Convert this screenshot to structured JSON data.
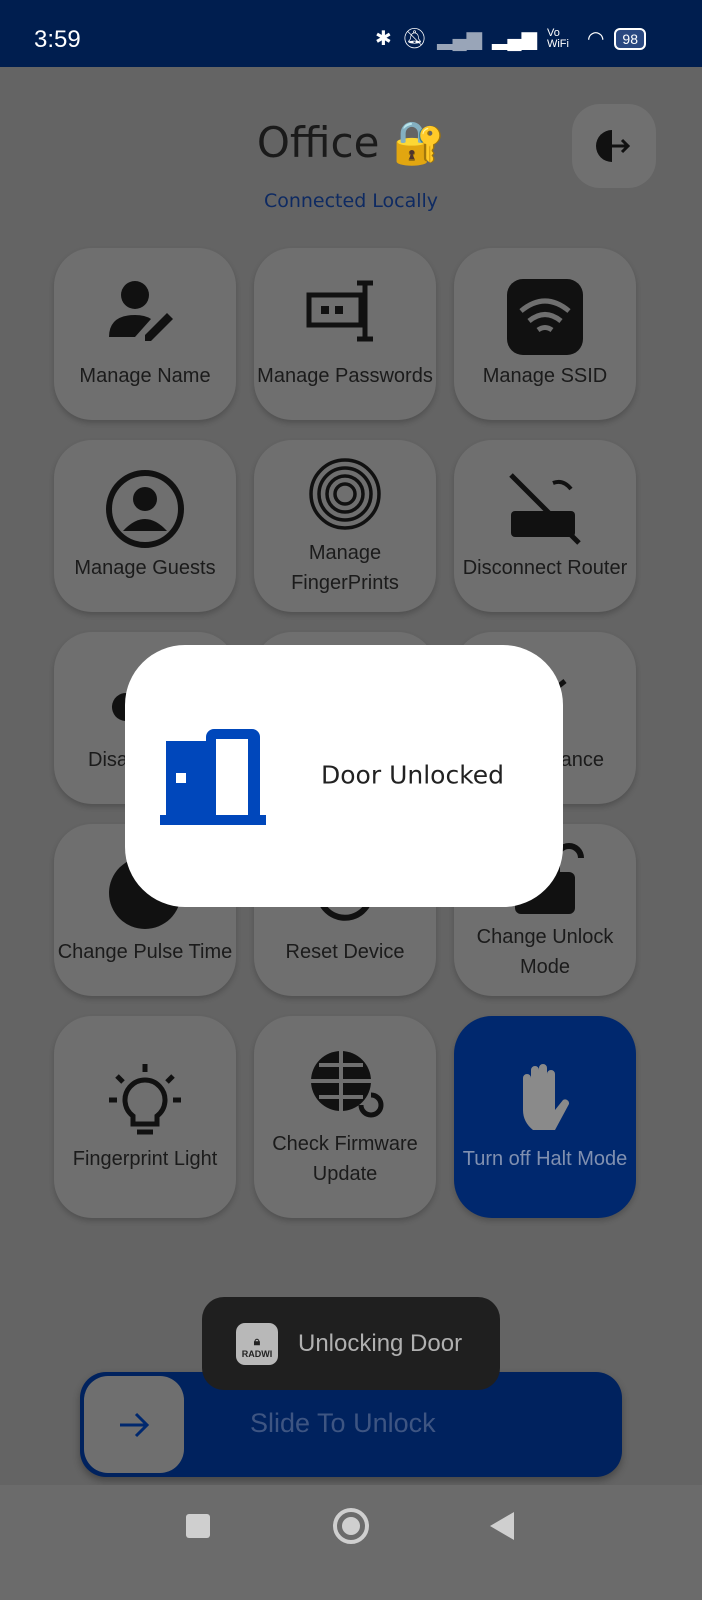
{
  "status_bar": {
    "time": "3:59",
    "battery": "98",
    "network_label": "Vo WiFi",
    "icons": [
      "bluetooth-icon",
      "mute-icon",
      "signal-icon",
      "signal-icon",
      "vowifi-icon",
      "wifi-icon",
      "battery-icon"
    ]
  },
  "header": {
    "title": "Office",
    "title_emoji": "🔐",
    "subtitle": "Connected Locally",
    "exit_icon": "exit-door-icon"
  },
  "tiles": [
    {
      "label": "Manage Name",
      "icon": "user-edit-icon"
    },
    {
      "label": "Manage Passwords",
      "icon": "password-field-icon"
    },
    {
      "label": "Manage SSID",
      "icon": "wifi-box-icon"
    },
    {
      "label": "Manage Guests",
      "icon": "user-circle-icon"
    },
    {
      "label": "Manage FingerPrints",
      "icon": "fingerprint-icon"
    },
    {
      "label": "Disconnect Router",
      "icon": "router-off-icon"
    },
    {
      "label": "Disa",
      "icon": "cloud-icon"
    },
    {
      "label": "",
      "icon": ""
    },
    {
      "label": "ance",
      "icon": "edit-icon"
    },
    {
      "label": "Change Pulse Time",
      "icon": "moon-icon"
    },
    {
      "label": "Reset Device",
      "icon": "reset-icon"
    },
    {
      "label": "Change Unlock Mode",
      "icon": "lock-open-icon"
    },
    {
      "label": "Fingerprint Light",
      "icon": "lightbulb-icon"
    },
    {
      "label": "Check Firmware Update",
      "icon": "globe-refresh-icon"
    },
    {
      "label": "Turn off Halt Mode",
      "icon": "hand-icon"
    }
  ],
  "modal": {
    "message": "Door Unlocked",
    "icon": "door-open-icon",
    "accent": "#0047bb"
  },
  "toast": {
    "message": "Unlocking Door",
    "app_name": "RADWI"
  },
  "slider": {
    "label": "Slide To Unlock",
    "progress": 0
  },
  "colors": {
    "status_bar": "#001e4f",
    "accent": "#00286e"
  }
}
